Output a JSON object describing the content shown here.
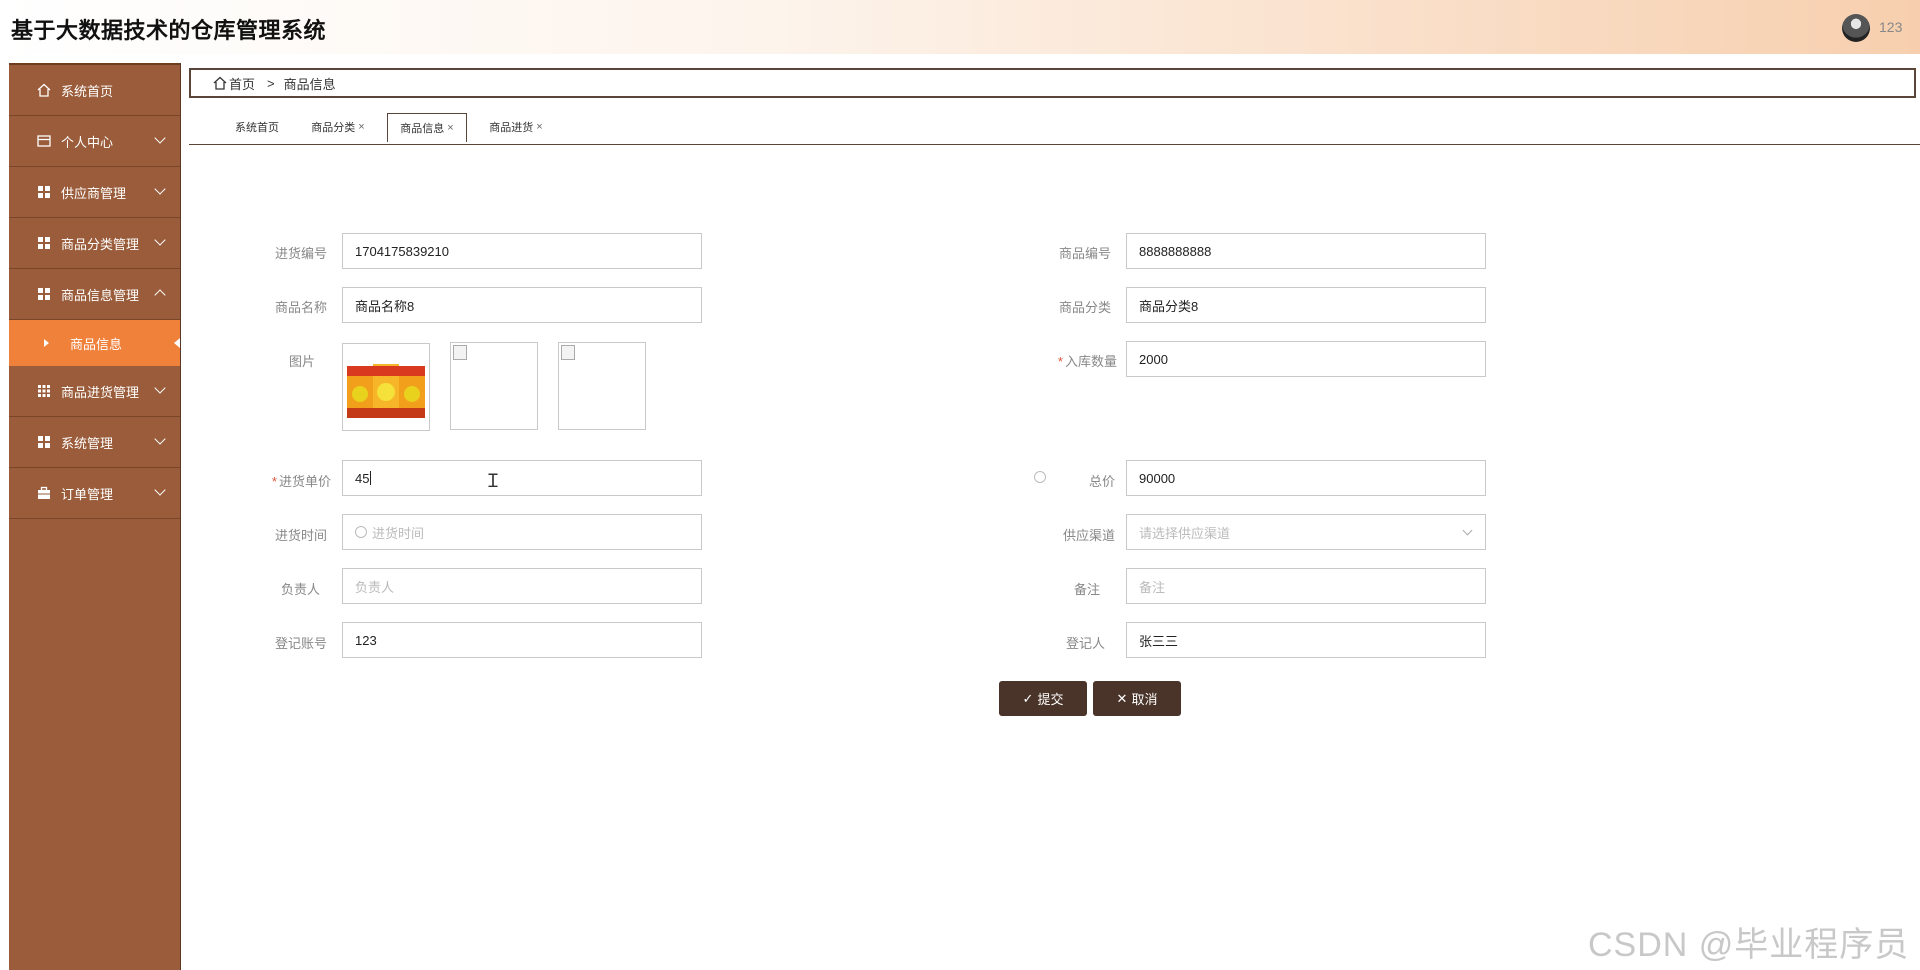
{
  "app": {
    "title": "基于大数据技术的仓库管理系统",
    "username": "123"
  },
  "sidebar": {
    "items": [
      {
        "label": "系统首页",
        "icon": "home-icon"
      },
      {
        "label": "个人中心",
        "icon": "card-icon"
      },
      {
        "label": "供应商管理",
        "icon": "grid-icon"
      },
      {
        "label": "商品分类管理",
        "icon": "grid-icon"
      },
      {
        "label": "商品信息管理",
        "icon": "grid-icon"
      },
      {
        "label": "商品进货管理",
        "icon": "grid9-icon"
      },
      {
        "label": "系统管理",
        "icon": "grid-icon"
      },
      {
        "label": "订单管理",
        "icon": "briefcase-icon"
      }
    ],
    "active_sub": "商品信息"
  },
  "breadcrumb": {
    "home": "首页",
    "sep": ">",
    "current": "商品信息"
  },
  "tabs": [
    {
      "label": "系统首页"
    },
    {
      "label": "商品分类"
    },
    {
      "label": "商品信息"
    },
    {
      "label": "商品进货"
    }
  ],
  "tab_close": "×",
  "form": {
    "purchase_no": {
      "label": "进货编号",
      "value": "1704175839210"
    },
    "product_no": {
      "label": "商品编号",
      "value": "8888888888"
    },
    "product_name": {
      "label": "商品名称",
      "value": "商品名称8"
    },
    "product_category": {
      "label": "商品分类",
      "value": "商品分类8"
    },
    "image": {
      "label": "图片"
    },
    "stock_qty": {
      "label": "入库数量",
      "value": "2000",
      "required": "*"
    },
    "unit_price": {
      "label": "进货单价",
      "value": "45",
      "required": "*"
    },
    "total": {
      "label": "总价",
      "value": "90000"
    },
    "purchase_time": {
      "label": "进货时间",
      "placeholder": "进货时间"
    },
    "channel": {
      "label": "供应渠道",
      "placeholder": "请选择供应渠道"
    },
    "manager": {
      "label": "负责人",
      "placeholder": "负责人"
    },
    "remark": {
      "label": "备注",
      "placeholder": "备注"
    },
    "account": {
      "label": "登记账号",
      "value": "123"
    },
    "registrar": {
      "label": "登记人",
      "value": "张三三"
    }
  },
  "buttons": {
    "submit": "提交",
    "cancel": "取消"
  },
  "watermark": "CSDN @毕业程序员"
}
